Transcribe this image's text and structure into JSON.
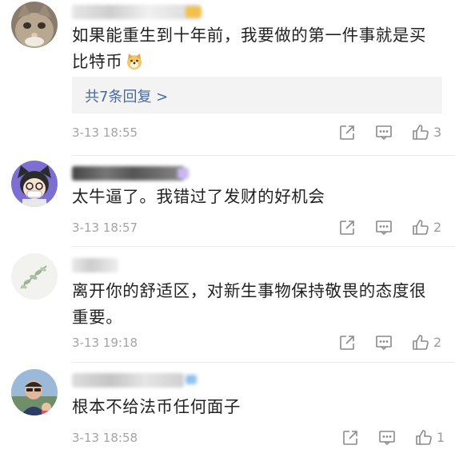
{
  "comments": [
    {
      "text": "如果能重生到十年前，我要做的第一件事就是买比特币",
      "replies_label": "共7条回复 >",
      "timestamp": "3-13 18:55",
      "likes": "3",
      "emoji_icon": "doge-icon"
    },
    {
      "text": "太牛逼了。我错过了发财的好机会",
      "timestamp": "3-13 18:57",
      "likes": "2"
    },
    {
      "text": "离开你的舒适区，对新生事物保持敬畏的态度很重要。",
      "timestamp": "3-13 19:18",
      "likes": "2"
    },
    {
      "text": "根本不给法币任何面子",
      "timestamp": "3-13 18:58",
      "likes": "1"
    }
  ],
  "colors": {
    "text": "#222222",
    "meta": "#a4a4a4",
    "reply_link": "#4a6a9b",
    "reply_bg": "#f3f3f3",
    "divider": "#ececec"
  }
}
